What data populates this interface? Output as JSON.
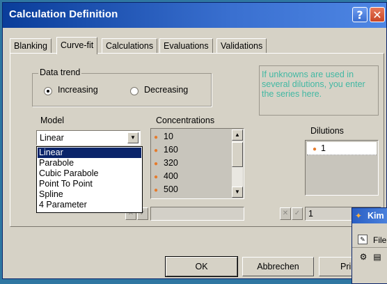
{
  "window": {
    "title": "Calculation Definition"
  },
  "titlebar": {
    "help_glyph": "?",
    "close_glyph": "✕"
  },
  "tabs": [
    {
      "label": "Blanking"
    },
    {
      "label": "Curve-fit"
    },
    {
      "label": "Calculations"
    },
    {
      "label": "Evaluations"
    },
    {
      "label": "Validations"
    }
  ],
  "data_trend": {
    "label": "Data trend",
    "increasing": "Increasing",
    "decreasing": "Decreasing",
    "selected": "increasing"
  },
  "model": {
    "label": "Model",
    "selected": "Linear",
    "options": [
      "Linear",
      "Parabole",
      "Cubic Parabole",
      "Point To Point",
      "Spline",
      "4 Parameter"
    ]
  },
  "concentrations": {
    "label": "Concentrations",
    "values": [
      "10",
      "160",
      "320",
      "400",
      "500"
    ],
    "input_value": ""
  },
  "info_text": "If unknowns are used in several dilutions, you enter the series here.",
  "dilutions": {
    "label": "Dilutions",
    "values": [
      "1"
    ],
    "input_value": "1"
  },
  "buttons": {
    "ok": "OK",
    "cancel": "Abbrechen",
    "print": "Pri"
  },
  "background_window": {
    "title": "Kim",
    "menu_file": "File"
  }
}
